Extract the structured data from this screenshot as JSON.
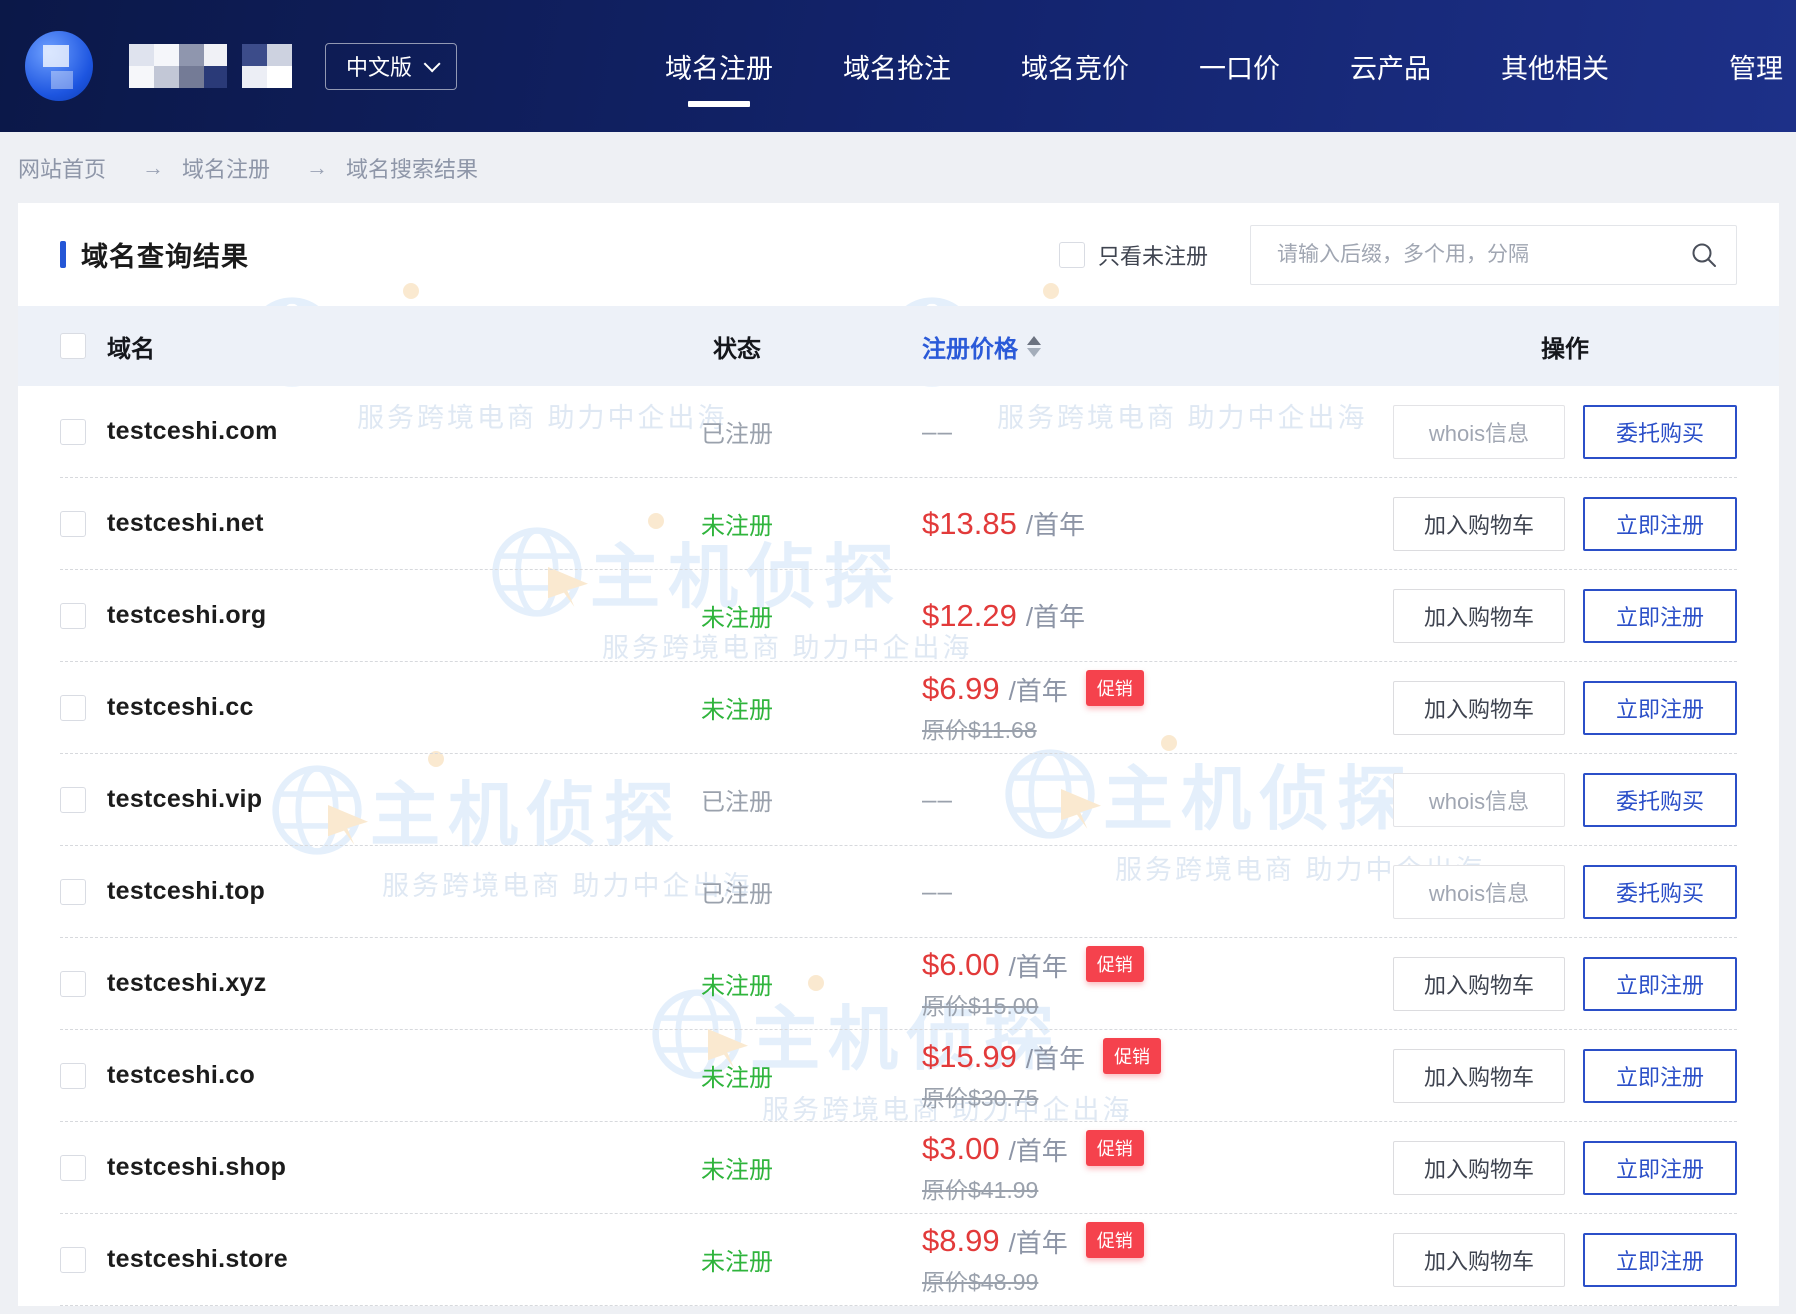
{
  "navbar": {
    "lang_button": "中文版",
    "items": [
      {
        "label": "域名注册"
      },
      {
        "label": "域名抢注"
      },
      {
        "label": "域名竞价"
      },
      {
        "label": "一口价"
      },
      {
        "label": "云产品"
      },
      {
        "label": "其他相关"
      },
      {
        "label": "管理"
      }
    ]
  },
  "breadcrumb": {
    "separator": "→",
    "items": [
      "网站首页",
      "域名注册",
      "域名搜索结果"
    ]
  },
  "toolbar": {
    "title": "域名查询结果",
    "filter_label": "只看未注册",
    "search_placeholder": "请输入后缀，多个用，分隔"
  },
  "table": {
    "headers": {
      "domain": "域名",
      "status": "状态",
      "price": "注册价格",
      "action": "操作"
    },
    "rows": [
      {
        "domain": "testceshi.com",
        "status": "已注册",
        "price_dash": "––",
        "btn1": "whois信息",
        "btn2": "委托购买"
      },
      {
        "domain": "testceshi.net",
        "status": "未注册",
        "price": "$13.85",
        "unit": "/首年",
        "btn1": "加入购物车",
        "btn2": "立即注册"
      },
      {
        "domain": "testceshi.org",
        "status": "未注册",
        "price": "$12.29",
        "unit": "/首年",
        "btn1": "加入购物车",
        "btn2": "立即注册"
      },
      {
        "domain": "testceshi.cc",
        "status": "未注册",
        "price": "$6.99",
        "unit": "/首年",
        "promo": "促销",
        "original": "原价$11.68",
        "btn1": "加入购物车",
        "btn2": "立即注册"
      },
      {
        "domain": "testceshi.vip",
        "status": "已注册",
        "price_dash": "––",
        "btn1": "whois信息",
        "btn2": "委托购买"
      },
      {
        "domain": "testceshi.top",
        "status": "已注册",
        "price_dash": "––",
        "btn1": "whois信息",
        "btn2": "委托购买"
      },
      {
        "domain": "testceshi.xyz",
        "status": "未注册",
        "price": "$6.00",
        "unit": "/首年",
        "promo": "促销",
        "original": "原价$15.00",
        "btn1": "加入购物车",
        "btn2": "立即注册"
      },
      {
        "domain": "testceshi.co",
        "status": "未注册",
        "price": "$15.99",
        "unit": "/首年",
        "promo": "促销",
        "original": "原价$30.75",
        "btn1": "加入购物车",
        "btn2": "立即注册"
      },
      {
        "domain": "testceshi.shop",
        "status": "未注册",
        "price": "$3.00",
        "unit": "/首年",
        "promo": "促销",
        "original": "原价$41.99",
        "btn1": "加入购物车",
        "btn2": "立即注册"
      },
      {
        "domain": "testceshi.store",
        "status": "未注册",
        "price": "$8.99",
        "unit": "/首年",
        "promo": "促销",
        "original": "原价$48.99",
        "btn1": "加入购物车",
        "btn2": "立即注册"
      }
    ]
  },
  "watermark": {
    "text": "主机侦探",
    "tagline": "服务跨境电商 助力中企出海"
  },
  "colors": {
    "navbar_dark": "#0b1848",
    "accent_blue": "#2b5ad8",
    "primary_btn_blue": "#2b4fc8",
    "status_green": "#2fb43c",
    "status_gray": "#9aa1ac",
    "price_red": "#e23a3a",
    "promo_badge_red": "#f5424d",
    "watermark_blue": "#cfe3f8"
  }
}
